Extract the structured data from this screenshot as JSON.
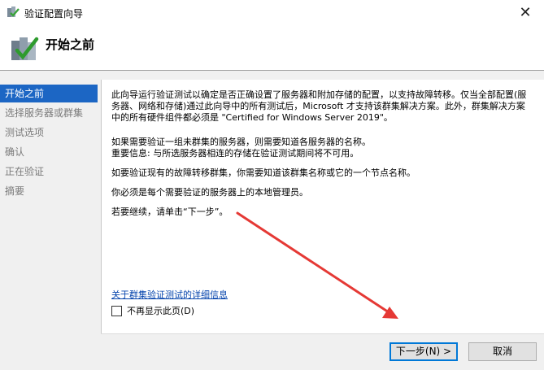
{
  "window": {
    "title": "验证配置向导",
    "close_glyph": "✕"
  },
  "header": {
    "heading": "开始之前"
  },
  "nav": {
    "items": [
      {
        "label": "开始之前",
        "active": true
      },
      {
        "label": "选择服务器或群集"
      },
      {
        "label": "测试选项"
      },
      {
        "label": "确认"
      },
      {
        "label": "正在验证"
      },
      {
        "label": "摘要"
      }
    ]
  },
  "content": {
    "p1": "此向导运行验证测试以确定是否正确设置了服务器和附加存储的配置，以支持故障转移。仅当全部配置(服务器、网络和存储)通过此向导中的所有测试后，Microsoft 才支持该群集解决方案。此外，群集解决方案中的所有硬件组件都必须是 \"Certified for Windows Server 2019\"。",
    "p2": "如果需要验证一组未群集的服务器，则需要知道各服务器的名称。",
    "p3": "重要信息: 与所选服务器相连的存储在验证测试期间将不可用。",
    "p4": "如要验证现有的故障转移群集，你需要知道该群集名称或它的一个节点名称。",
    "p5": "你必须是每个需要验证的服务器上的本地管理员。",
    "p6": "若要继续，请单击“下一步”。",
    "link": "关于群集验证测试的详细信息",
    "checkbox_label": "不再显示此页(D)",
    "checkbox_checked": false
  },
  "buttons": {
    "next": "下一步(N) >",
    "cancel": "取消"
  },
  "colors": {
    "accent": "#1c66c4",
    "link": "#0645ad",
    "annotation_arrow": "#e53935"
  }
}
